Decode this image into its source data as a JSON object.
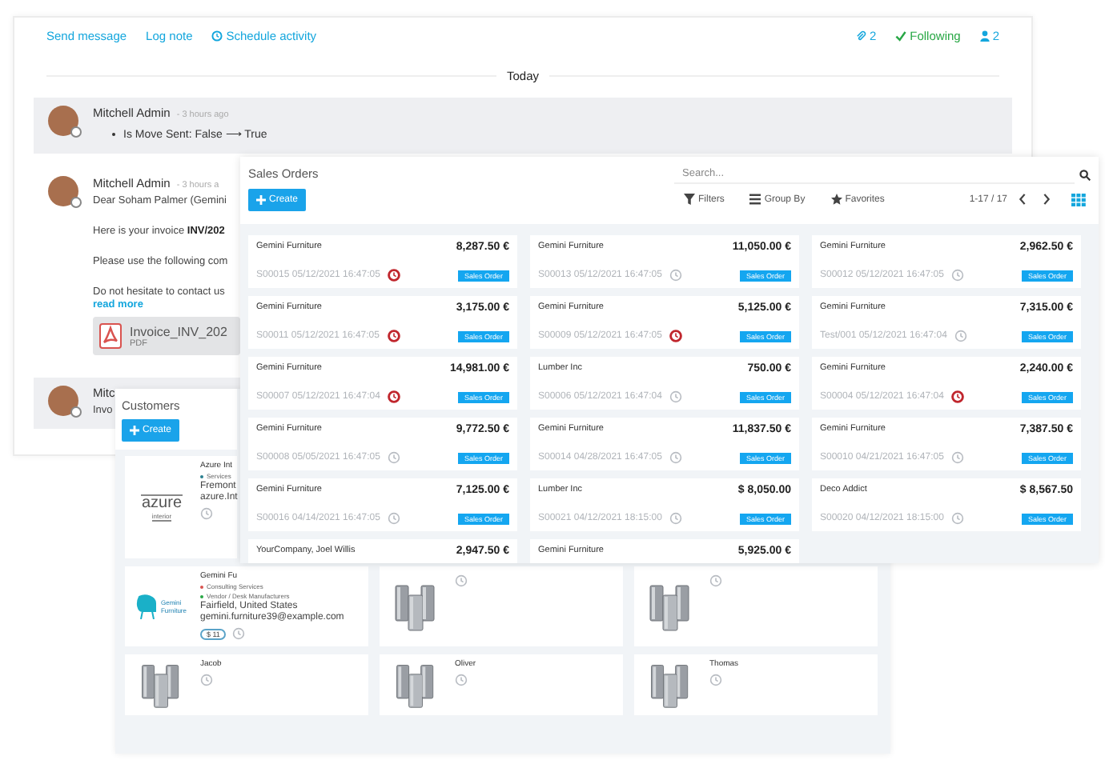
{
  "chatter": {
    "actions": [
      {
        "label": "Send message",
        "kind": "link"
      },
      {
        "label": "Log note",
        "kind": "link"
      },
      {
        "label": "Schedule activity",
        "kind": "activity"
      }
    ],
    "counters": [
      {
        "label": "2",
        "kind": "attachments"
      },
      {
        "label": "Following",
        "kind": "following"
      },
      {
        "label": "2",
        "kind": "followers"
      }
    ],
    "date_separator": "Today",
    "messages": [
      {
        "author": "Mitchell Admin",
        "time": "- 3 hours ago",
        "highlighted": true,
        "tracking": "Is Move Sent: False ⟶ True"
      },
      {
        "author": "Mitchell Admin",
        "time": "- 3 hours a",
        "highlighted": false,
        "body": [
          "Dear Soham Palmer (Gemini",
          "Here is your invoice **INV/202**",
          "Please use the following com",
          "Do not hesitate to contact us"
        ],
        "read_more": "read more",
        "attachment": {
          "name": "Invoice_INV_202",
          "type": "PDF"
        }
      },
      {
        "author": "Mitc",
        "highlighted": true,
        "body": [
          "Invo"
        ]
      }
    ]
  },
  "customers": {
    "title": "Customers",
    "create_button": "Create",
    "rows": [
      [
        {
          "kind": "azure",
          "logo_text": [
            "azure",
            "interior"
          ],
          "name": "Azure Int",
          "tags": [
            {
              "label": "Services",
              "color": "#2a7f8f"
            }
          ],
          "lines": [
            "Fremont",
            "azure.Int"
          ]
        }
      ],
      [
        {
          "kind": "gemini",
          "logo_text": [
            "Gemini",
            "Furniture"
          ],
          "name": "Gemini Fu",
          "tags": [
            {
              "label": "Consulting Services",
              "color": "#d9534f"
            },
            {
              "label": "Vendor / Desk Manufacturers",
              "color": "#28a745"
            }
          ],
          "lines": [
            "Fairfield, United States",
            "gemini.furniture39@example.com"
          ],
          "badge": "$ 11"
        },
        {
          "kind": "building"
        },
        {
          "kind": "building"
        }
      ],
      [
        {
          "kind": "building",
          "name": "Jacob"
        },
        {
          "kind": "building",
          "name": "Oliver"
        },
        {
          "kind": "building",
          "name": "Thomas"
        }
      ]
    ]
  },
  "sales_orders": {
    "title": "Sales Orders",
    "create_button": "Create",
    "search": {
      "placeholder": "Search..."
    },
    "filters": [
      "Filters",
      "Group By",
      "Favorites"
    ],
    "pager": "1-17 / 17",
    "cards": [
      {
        "customer": "Gemini Furniture",
        "amount": "8,287.50 €",
        "reference": "S00015 05/12/2021 16:47:05",
        "overdue": true,
        "tag": "Sales Order"
      },
      {
        "customer": "Gemini Furniture",
        "amount": "11,050.00 €",
        "reference": "S00013 05/12/2021 16:47:05",
        "overdue": false,
        "tag": "Sales Order"
      },
      {
        "customer": "Gemini Furniture",
        "amount": "2,962.50 €",
        "reference": "S00012 05/12/2021 16:47:05",
        "overdue": false,
        "tag": "Sales Order"
      },
      {
        "customer": "Gemini Furniture",
        "amount": "3,175.00 €",
        "reference": "S00011 05/12/2021 16:47:05",
        "overdue": true,
        "tag": "Sales Order"
      },
      {
        "customer": "Gemini Furniture",
        "amount": "5,125.00 €",
        "reference": "S00009 05/12/2021 16:47:05",
        "overdue": true,
        "tag": "Sales Order"
      },
      {
        "customer": "Gemini Furniture",
        "amount": "7,315.00 €",
        "reference": "Test/001 05/12/2021 16:47:04",
        "overdue": false,
        "tag": "Sales Order"
      },
      {
        "customer": "Gemini Furniture",
        "amount": "14,981.00 €",
        "reference": "S00007 05/12/2021 16:47:04",
        "overdue": true,
        "tag": "Sales Order"
      },
      {
        "customer": "Lumber Inc",
        "amount": "750.00 €",
        "reference": "S00006 05/12/2021 16:47:04",
        "overdue": false,
        "tag": "Sales Order"
      },
      {
        "customer": "Gemini Furniture",
        "amount": "2,240.00 €",
        "reference": "S00004 05/12/2021 16:47:04",
        "overdue": true,
        "tag": "Sales Order"
      },
      {
        "customer": "Gemini Furniture",
        "amount": "9,772.50 €",
        "reference": "S00008 05/05/2021 16:47:05",
        "overdue": false,
        "tag": "Sales Order"
      },
      {
        "customer": "Gemini Furniture",
        "amount": "11,837.50 €",
        "reference": "S00014 04/28/2021 16:47:05",
        "overdue": false,
        "tag": "Sales Order"
      },
      {
        "customer": "Gemini Furniture",
        "amount": "7,387.50 €",
        "reference": "S00010 04/21/2021 16:47:05",
        "overdue": false,
        "tag": "Sales Order"
      },
      {
        "customer": "Gemini Furniture",
        "amount": "7,125.00 €",
        "reference": "S00016 04/14/2021 16:47:05",
        "overdue": false,
        "tag": "Sales Order"
      },
      {
        "customer": "Lumber Inc",
        "amount": "$ 8,050.00",
        "reference": "S00021 04/12/2021 18:15:00",
        "overdue": false,
        "tag": "Sales Order"
      },
      {
        "customer": "Deco Addict",
        "amount": "$ 8,567.50",
        "reference": "S00020 04/12/2021 18:15:00",
        "overdue": false,
        "tag": "Sales Order"
      },
      {
        "customer": "YourCompany, Joel Willis",
        "amount": "2,947.50 €"
      },
      {
        "customer": "Gemini Furniture",
        "amount": "5,925.00 €"
      }
    ]
  }
}
